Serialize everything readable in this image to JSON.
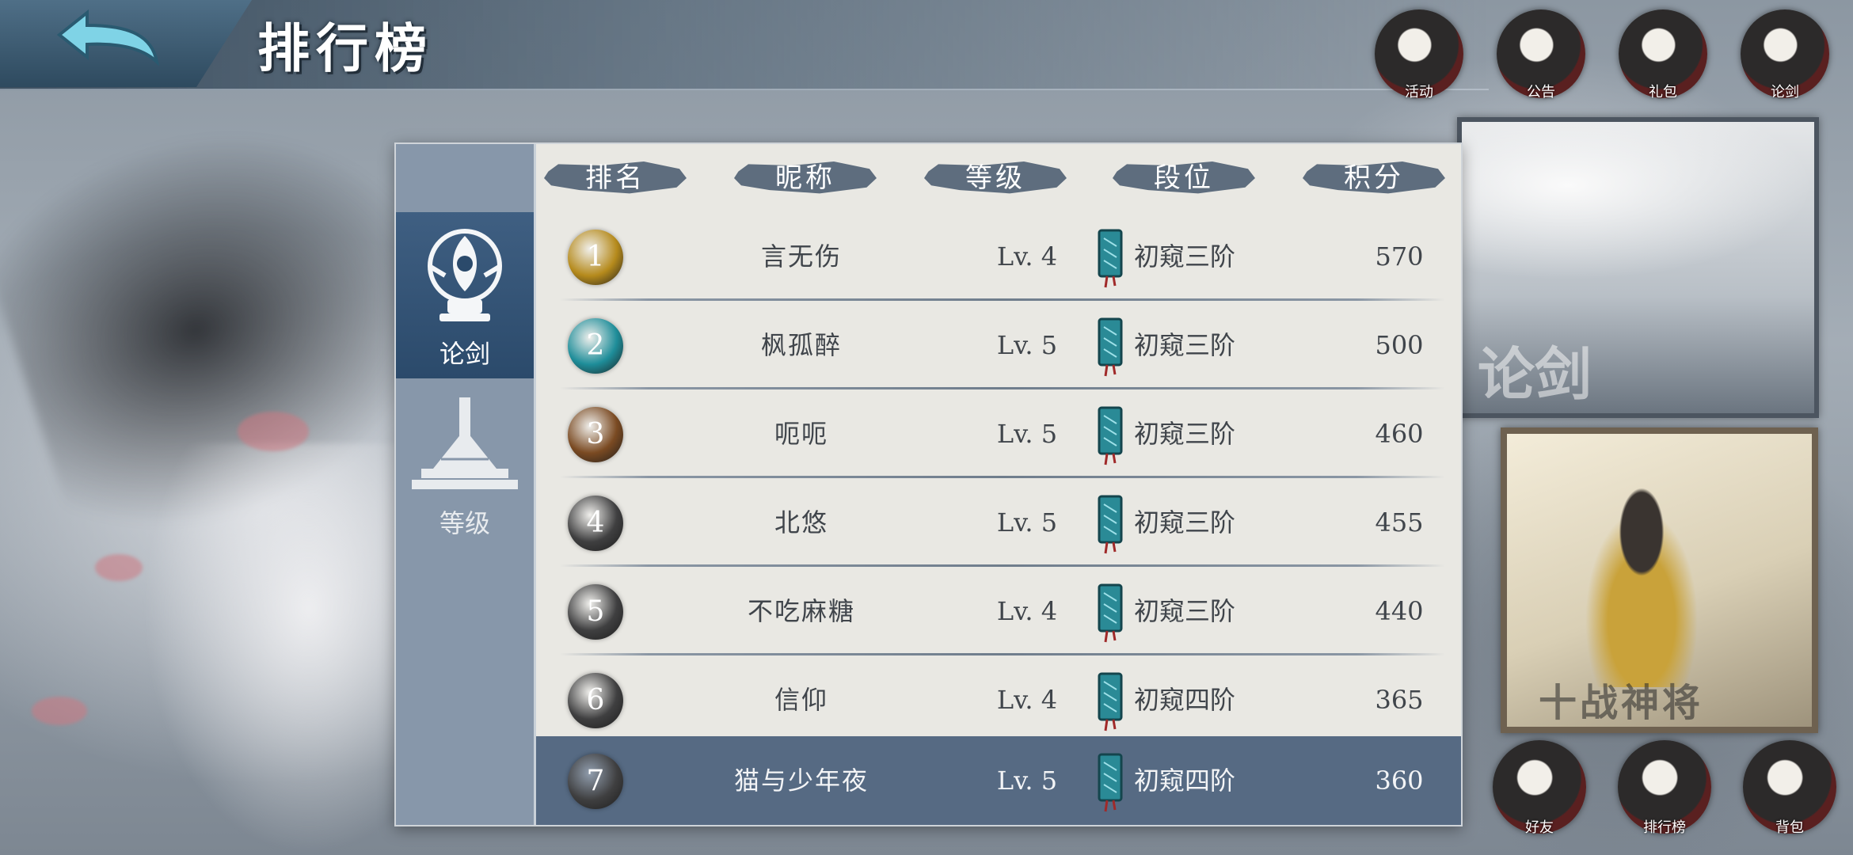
{
  "header": {
    "title": "排行榜"
  },
  "top_icons": [
    {
      "name": "scroll-icon",
      "label": "活动"
    },
    {
      "name": "portrait-icon",
      "label": "公告"
    },
    {
      "name": "card-icon",
      "label": "礼包"
    },
    {
      "name": "warrior-icon",
      "label": "论剑"
    }
  ],
  "side_panels": {
    "card1_text": "论剑",
    "card2_text": "十战神将"
  },
  "bottom_icons": [
    {
      "name": "mask-icon",
      "label": "好友"
    },
    {
      "name": "banner-icon",
      "label": "排行榜"
    },
    {
      "name": "bag-icon",
      "label": "背包"
    }
  ],
  "sidebar": {
    "tabs": [
      {
        "label": "论剑",
        "active": true,
        "icon": "emblem-icon"
      },
      {
        "label": "等级",
        "active": false,
        "icon": "pagoda-icon"
      }
    ]
  },
  "table": {
    "headers": [
      "排名",
      "昵称",
      "等级",
      "段位",
      "积分"
    ],
    "rows": [
      {
        "rank": "1",
        "name": "言无伤",
        "level": "Lv. 4",
        "tier": "初窥三阶",
        "score": "570",
        "badge_color": "#b58a1c"
      },
      {
        "rank": "2",
        "name": "枫孤醉",
        "level": "Lv. 5",
        "tier": "初窥三阶",
        "score": "500",
        "badge_color": "#1e8d99"
      },
      {
        "rank": "3",
        "name": "呃呃",
        "level": "Lv. 5",
        "tier": "初窥三阶",
        "score": "460",
        "badge_color": "#7a4a22"
      },
      {
        "rank": "4",
        "name": "北悠",
        "level": "Lv. 5",
        "tier": "初窥三阶",
        "score": "455",
        "badge_color": "#3f3f40"
      },
      {
        "rank": "5",
        "name": "不吃麻糖",
        "level": "Lv. 4",
        "tier": "初窥三阶",
        "score": "440",
        "badge_color": "#3f3f40"
      },
      {
        "rank": "6",
        "name": "信仰",
        "level": "Lv. 4",
        "tier": "初窥四阶",
        "score": "365",
        "badge_color": "#3f3f40"
      },
      {
        "rank": "7",
        "name": "猫与少年夜",
        "level": "Lv. 5",
        "tier": "初窥四阶",
        "score": "360",
        "badge_color": "#3f3f40"
      }
    ],
    "highlighted_rank": "7"
  },
  "colors": {
    "panel_bg": "#e9e8e3",
    "sidebar_bg": "#8797aa",
    "active_tab": "#2b4a6b",
    "highlight_row": "#566a83",
    "tier_icon": "#2a8a96"
  }
}
